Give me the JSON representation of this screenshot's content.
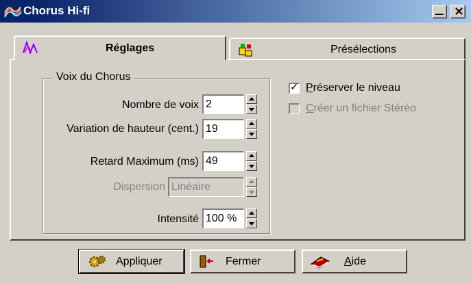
{
  "window": {
    "title": "Chorus Hi-fi"
  },
  "tabs": [
    {
      "label": "Réglages",
      "active": true,
      "icon": "waveform-icon"
    },
    {
      "label": "Présélections",
      "active": false,
      "icon": "presets-icon"
    }
  ],
  "group": {
    "title": "Voix du Chorus",
    "fields": [
      {
        "label": "Nombre de voix",
        "value": "2",
        "enabled": true
      },
      {
        "label": "Variation de hauteur (cent.)",
        "value": "19",
        "enabled": true
      },
      {
        "label": "Retard Maximum (ms)",
        "value": "49",
        "enabled": true
      },
      {
        "label": "Dispersion",
        "value": "Linéaire",
        "enabled": false
      },
      {
        "label": "Intensité",
        "value": "100 %",
        "enabled": true
      }
    ]
  },
  "options": [
    {
      "label_first": "P",
      "label_rest": "réserver le niveau",
      "checked": true,
      "enabled": true
    },
    {
      "label_first": "C",
      "label_rest": "réer un fichier Stéréo",
      "checked": false,
      "enabled": false
    }
  ],
  "buttons": [
    {
      "label": "Appliquer",
      "icon": "gears-icon"
    },
    {
      "label": "Fermer",
      "icon": "exit-door-icon"
    },
    {
      "label_first": "A",
      "label_rest": "ide",
      "icon": "help-book-icon"
    }
  ],
  "colors": {
    "titlebar_start": "#0a246a",
    "titlebar_end": "#a6caf0",
    "face": "#d4d0c8"
  }
}
